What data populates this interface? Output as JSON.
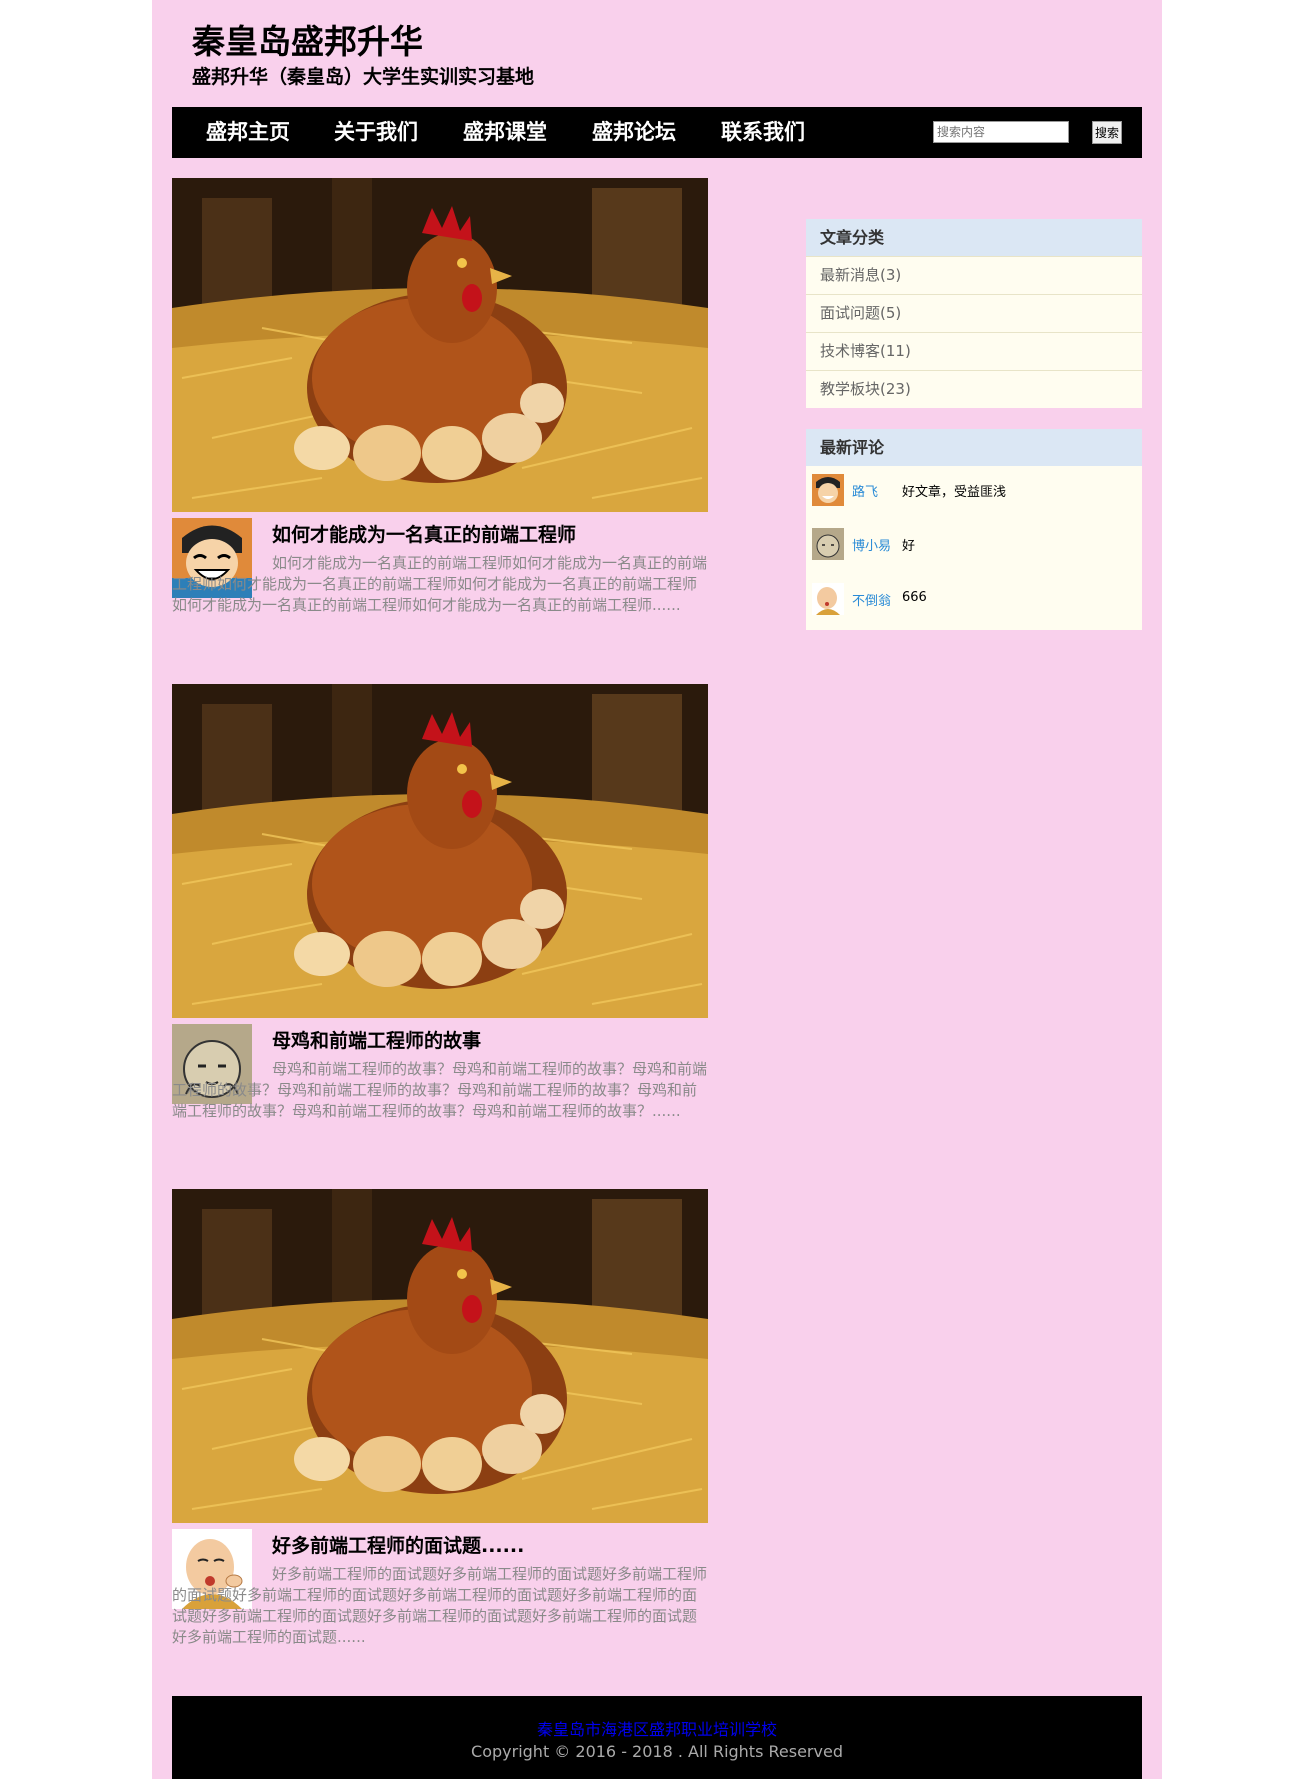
{
  "header": {
    "title": "秦皇岛盛邦升华",
    "subtitle": "盛邦升华（秦皇岛）大学生实训实习基地"
  },
  "nav": {
    "items": [
      "盛邦主页",
      "关于我们",
      "盛邦课堂",
      "盛邦论坛",
      "联系我们"
    ],
    "search_placeholder": "搜索内容",
    "search_button": "搜索"
  },
  "posts": [
    {
      "title": "如何才能成为一名真正的前端工程师",
      "excerpt": "如何才能成为一名真正的前端工程师如何才能成为一名真正的前端工程师如何才能成为一名真正的前端工程师如何才能成为一名真正的前端工程师如何才能成为一名真正的前端工程师如何才能成为一名真正的前端工程师......",
      "image": "hen-with-eggs-image",
      "avatar": "cartoon-boy-avatar"
    },
    {
      "title": "母鸡和前端工程师的故事",
      "excerpt": "母鸡和前端工程师的故事？母鸡和前端工程师的故事？母鸡和前端工程师的故事？母鸡和前端工程师的故事？母鸡和前端工程师的故事？母鸡和前端工程师的故事？母鸡和前端工程师的故事？母鸡和前端工程师的故事？......",
      "image": "hen-with-eggs-image",
      "avatar": "sketch-face-avatar"
    },
    {
      "title": "好多前端工程师的面试题......",
      "excerpt": "好多前端工程师的面试题好多前端工程师的面试题好多前端工程师的面试题好多前端工程师的面试题好多前端工程师的面试题好多前端工程师的面试题好多前端工程师的面试题好多前端工程师的面试题好多前端工程师的面试题好多前端工程师的面试题......",
      "image": "hen-with-eggs-image",
      "avatar": "cartoon-monk-avatar"
    }
  ],
  "sidebar": {
    "categories_title": "文章分类",
    "categories": [
      "最新消息(3)",
      "面试问题(5)",
      "技术博客(11)",
      "教学板块(23)"
    ],
    "comments_title": "最新评论",
    "comments": [
      {
        "user": "路飞",
        "text": "好文章，受益匪浅"
      },
      {
        "user": "博小易",
        "text": "好"
      },
      {
        "user": "不倒翁",
        "text": "666"
      }
    ]
  },
  "footer": {
    "school": "秦皇岛市海港区盛邦职业培训学校",
    "copyright": "Copyright © 2016 - 2018 . All Rights Reserved"
  },
  "colors": {
    "page_background": "#f9d0ec",
    "nav_background": "#000000",
    "sidebar_header": "#dbe7f4",
    "sidebar_body": "#fffdf0",
    "link": "#2a8bd6"
  }
}
